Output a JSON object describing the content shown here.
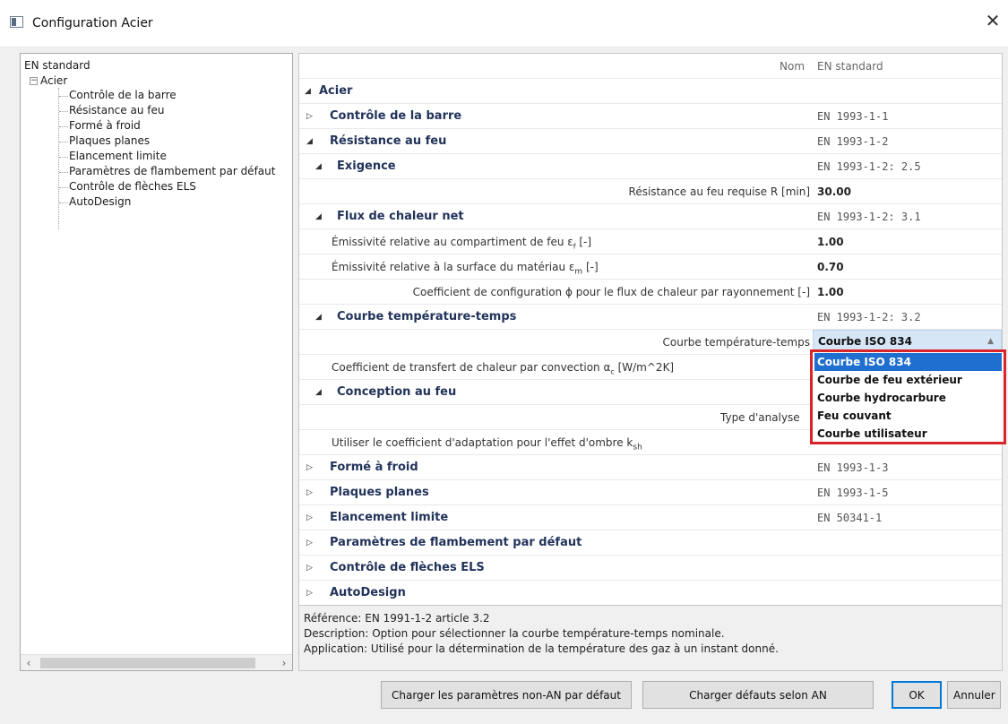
{
  "window": {
    "title": "Configuration Acier",
    "close_glyph": "✕"
  },
  "tree": {
    "root": "EN standard",
    "parent": "Acier",
    "children": [
      "Contrôle de la barre",
      "Résistance au feu",
      "Formé à froid",
      "Plaques planes",
      "Elancement limite",
      "Paramètres de flambement par défaut",
      "Contrôle de flèches ELS",
      "AutoDesign"
    ]
  },
  "grid": {
    "nom_label": "Nom",
    "nom_value": "EN standard",
    "acier": "Acier",
    "controle_barre": {
      "label": "Contrôle de la barre",
      "value": "EN 1993-1-1"
    },
    "resistance_feu": {
      "label": "Résistance au feu",
      "value": "EN 1993-1-2"
    },
    "exigence": {
      "label": "Exigence",
      "value": "EN 1993-1-2: 2.5"
    },
    "resistance_requise": {
      "label": "Résistance au feu requise R [min]",
      "value": "30.00"
    },
    "flux": {
      "label": "Flux de chaleur net",
      "value": "EN 1993-1-2: 3.1"
    },
    "emissivite_feu": {
      "label_pre": "Émissivité relative au compartiment de feu ε",
      "sub": "f",
      "label_post": " [-]",
      "value": "1.00"
    },
    "emissivite_mat": {
      "label_pre": "Émissivité relative à la surface du matériau ε",
      "sub": "m",
      "label_post": " [-]",
      "value": "0.70"
    },
    "coef_config": {
      "label": "Coefficient de configuration ϕ pour le flux de chaleur par rayonnement [-]",
      "value": "1.00"
    },
    "courbe_section": {
      "label": "Courbe température-temps",
      "value": "EN 1993-1-2: 3.2"
    },
    "courbe_field": {
      "label": "Courbe température-temps",
      "value": "Courbe ISO 834"
    },
    "coef_transfert": {
      "label_pre": "Coefficient de transfert de chaleur par convection α",
      "sub": "c",
      "label_post": " [W/m^2K]"
    },
    "conception": {
      "label": "Conception au feu"
    },
    "type_analyse": {
      "label": "Type d'analyse"
    },
    "coef_ombre": {
      "label_pre": "Utiliser le coefficient d'adaptation pour l'effet d'ombre k",
      "sub": "sh"
    },
    "forme_froid": {
      "label": "Formé à froid",
      "value": "EN 1993-1-3"
    },
    "plaques": {
      "label": "Plaques planes",
      "value": "EN 1993-1-5"
    },
    "elancement": {
      "label": "Elancement limite",
      "value": "EN 50341-1"
    },
    "flambement": {
      "label": "Paramètres de flambement par défaut"
    },
    "fleches": {
      "label": "Contrôle de flèches ELS"
    },
    "autodesign": {
      "label": "AutoDesign"
    }
  },
  "dropdown": {
    "options": [
      "Courbe ISO 834",
      "Courbe de feu extérieur",
      "Courbe hydrocarbure",
      "Feu couvant",
      "Courbe utilisateur"
    ],
    "selected_index": 0,
    "highlight_color": "#d9252a"
  },
  "info": {
    "reference": "Référence: EN 1991-1-2 article 3.2",
    "description": "Description: Option pour sélectionner la courbe température-temps nominale.",
    "application": "Application: Utilisé pour la détermination de la température des gaz à un instant donné."
  },
  "buttons": {
    "load_non_an": "Charger les paramètres non-AN par défaut",
    "load_an": "Charger défauts selon AN",
    "ok": "OK",
    "cancel": "Annuler"
  }
}
